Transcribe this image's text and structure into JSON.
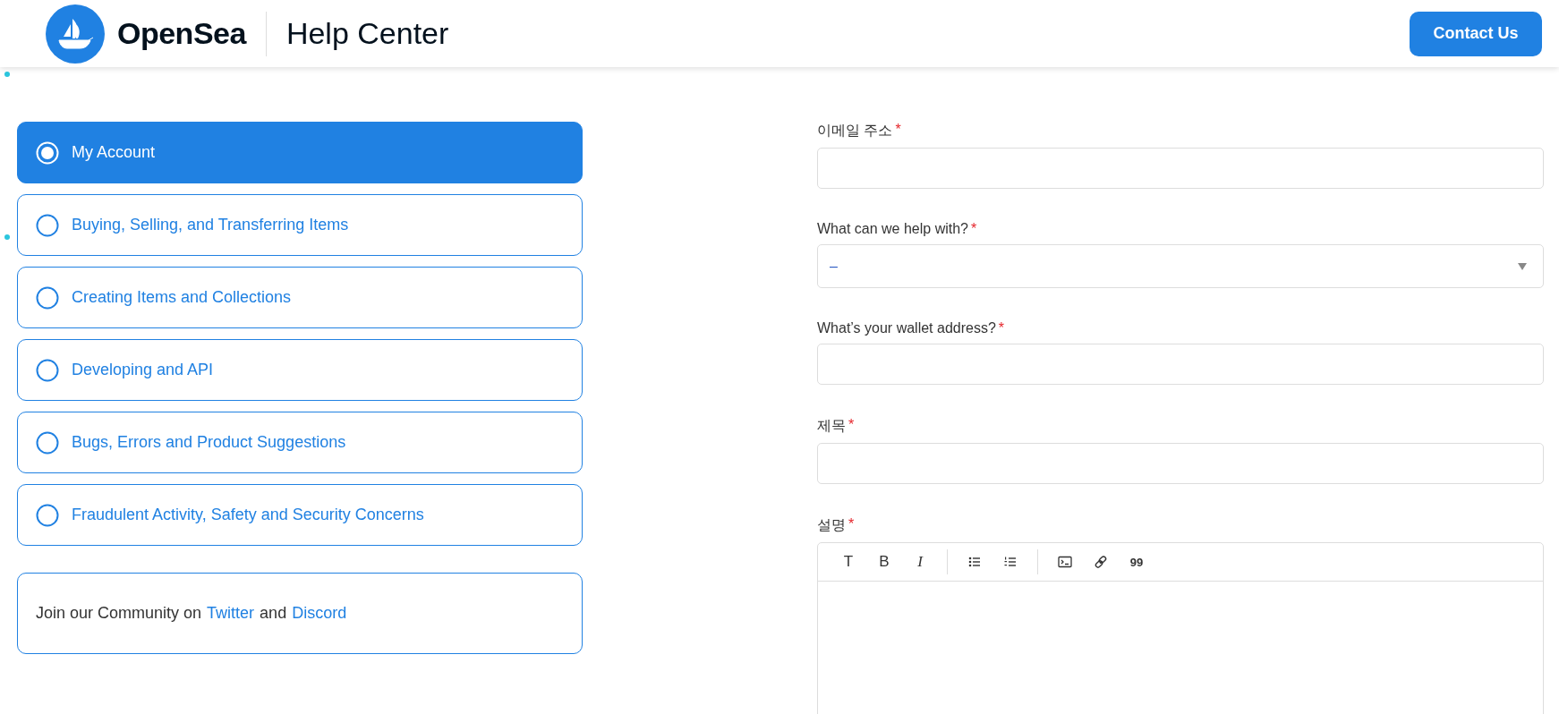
{
  "header": {
    "logo_text": "OpenSea",
    "section_title": "Help Center",
    "contact_button": "Contact Us"
  },
  "categories": [
    {
      "label": "My Account",
      "selected": true
    },
    {
      "label": "Buying, Selling, and Transferring Items",
      "selected": false
    },
    {
      "label": "Creating Items and Collections",
      "selected": false
    },
    {
      "label": "Developing and API",
      "selected": false
    },
    {
      "label": "Bugs, Errors and Product Suggestions",
      "selected": false
    },
    {
      "label": "Fraudulent Activity, Safety and Security Concerns",
      "selected": false
    }
  ],
  "community": {
    "text": "Join our Community on",
    "link_1": "Twitter",
    "joiner": "and",
    "link_2": "Discord"
  },
  "form_fields": [
    {
      "kind": "input",
      "label": "이메일 주소",
      "required_mark": "*"
    },
    {
      "kind": "select",
      "label": "What can we help with?",
      "required_mark": "*",
      "value": "–"
    },
    {
      "kind": "input",
      "label": "What’s your wallet address?",
      "required_mark": "*"
    },
    {
      "kind": "input",
      "label": "제목",
      "required_mark": "*"
    },
    {
      "kind": "editor",
      "label": "설명",
      "required_mark": "*"
    }
  ],
  "editor_toolbar": [
    [
      {
        "kind": "text",
        "label": "T"
      },
      {
        "kind": "bold",
        "label": "B"
      },
      {
        "kind": "italic",
        "label": "I"
      }
    ],
    [
      {
        "kind": "bullet-list"
      },
      {
        "kind": "numbered-list"
      }
    ],
    [
      {
        "kind": "code"
      },
      {
        "kind": "link"
      },
      {
        "kind": "text",
        "label": "99"
      }
    ]
  ]
}
